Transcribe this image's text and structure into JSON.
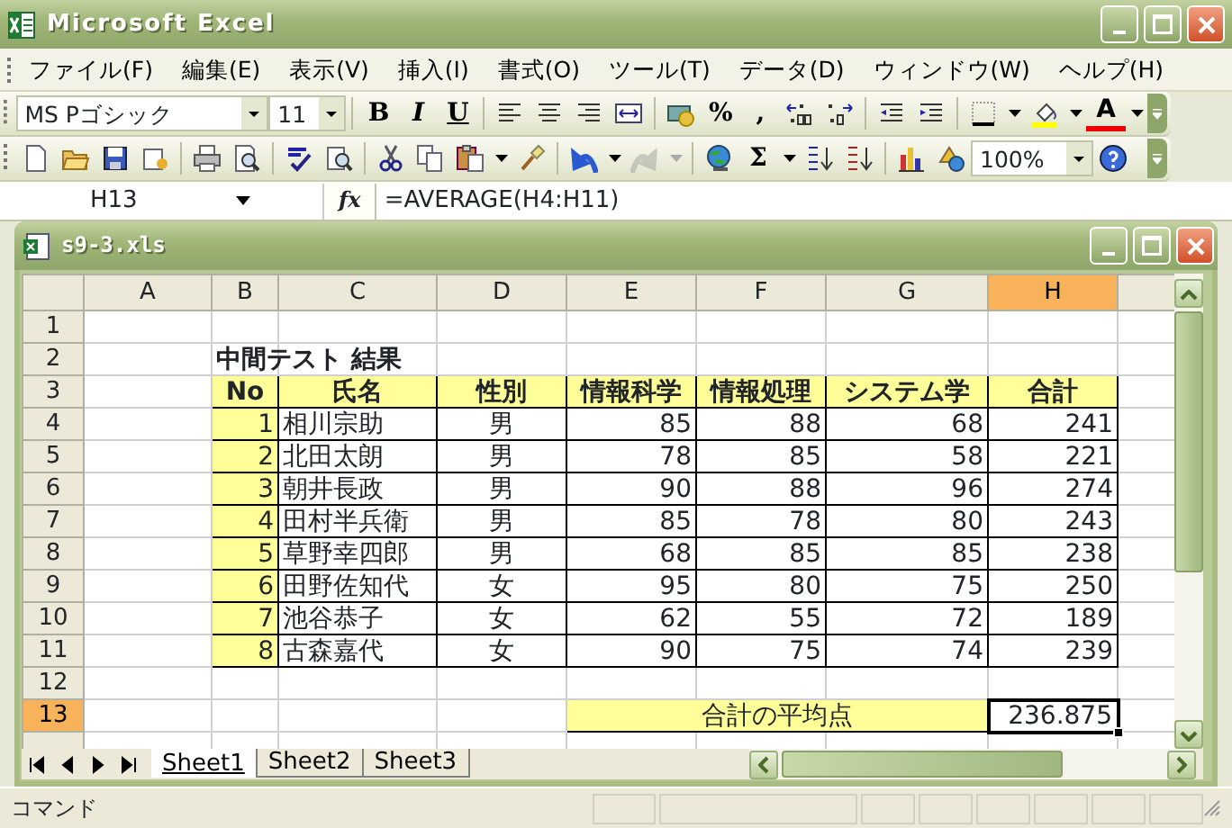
{
  "window": {
    "title": "Microsoft Excel"
  },
  "menu": [
    {
      "label": "ファイル(F)"
    },
    {
      "label": "編集(E)"
    },
    {
      "label": "表示(V)"
    },
    {
      "label": "挿入(I)"
    },
    {
      "label": "書式(O)"
    },
    {
      "label": "ツール(T)"
    },
    {
      "label": "データ(D)"
    },
    {
      "label": "ウィンドウ(W)"
    },
    {
      "label": "ヘルプ(H)"
    }
  ],
  "formatting_toolbar": [
    {
      "kind": "grip"
    },
    {
      "kind": "combo",
      "value": "MS Pゴシック"
    },
    {
      "kind": "combo",
      "value": "11"
    },
    {
      "kind": "sep"
    },
    {
      "kind": "glyph",
      "text": "B"
    },
    {
      "kind": "glyph",
      "text": "I"
    },
    {
      "kind": "glyph",
      "text": "U"
    },
    {
      "kind": "sep"
    },
    {
      "kind": "icon"
    },
    {
      "kind": "icon"
    },
    {
      "kind": "icon"
    },
    {
      "kind": "icon"
    },
    {
      "kind": "sep"
    },
    {
      "kind": "icon"
    },
    {
      "kind": "glyph",
      "text": "%"
    },
    {
      "kind": "glyph",
      "text": ","
    },
    {
      "kind": "icon"
    },
    {
      "kind": "icon"
    },
    {
      "kind": "sep"
    },
    {
      "kind": "icon"
    },
    {
      "kind": "icon"
    },
    {
      "kind": "sep"
    },
    {
      "kind": "icon"
    },
    {
      "kind": "dropdown"
    },
    {
      "kind": "icon"
    },
    {
      "kind": "dropdown"
    },
    {
      "kind": "glyph",
      "text": "A"
    },
    {
      "kind": "dropdown"
    },
    {
      "kind": "options"
    }
  ],
  "standard_toolbar": [
    {
      "kind": "grip"
    },
    {
      "kind": "icon",
      "disabled": false
    },
    {
      "kind": "icon",
      "disabled": false
    },
    {
      "kind": "icon",
      "disabled": false
    },
    {
      "kind": "icon",
      "disabled": false
    },
    {
      "kind": "sep"
    },
    {
      "kind": "icon",
      "disabled": false
    },
    {
      "kind": "icon",
      "disabled": false
    },
    {
      "kind": "sep"
    },
    {
      "kind": "icon",
      "disabled": false
    },
    {
      "kind": "icon",
      "disabled": false
    },
    {
      "kind": "sep"
    },
    {
      "kind": "icon",
      "disabled": false
    },
    {
      "kind": "icon",
      "disabled": false
    },
    {
      "kind": "icon",
      "disabled": false
    },
    {
      "kind": "dropdown",
      "disabled": false
    },
    {
      "kind": "icon",
      "disabled": false
    },
    {
      "kind": "sep"
    },
    {
      "kind": "icon",
      "disabled": false
    },
    {
      "kind": "dropdown",
      "disabled": false
    },
    {
      "kind": "icon",
      "disabled": true
    },
    {
      "kind": "dropdown",
      "disabled": true
    },
    {
      "kind": "sep"
    },
    {
      "kind": "icon",
      "disabled": false
    },
    {
      "kind": "glyph",
      "text": "Σ"
    },
    {
      "kind": "dropdown",
      "disabled": false
    },
    {
      "kind": "icon",
      "disabled": false
    },
    {
      "kind": "icon",
      "disabled": false
    },
    {
      "kind": "sep"
    },
    {
      "kind": "icon",
      "disabled": false
    },
    {
      "kind": "icon",
      "disabled": false
    },
    {
      "kind": "combo",
      "value": "100%"
    },
    {
      "kind": "icon",
      "disabled": false
    },
    {
      "kind": "options"
    }
  ],
  "formula_bar": {
    "name_box": "H13",
    "fx": "fx",
    "formula": "=AVERAGE(H4:H11)"
  },
  "workbook": {
    "title": "s9-3.xls"
  },
  "sheet": {
    "columns": [
      {
        "label": "A",
        "selected": false
      },
      {
        "label": "B",
        "selected": false
      },
      {
        "label": "C",
        "selected": false
      },
      {
        "label": "D",
        "selected": false
      },
      {
        "label": "E",
        "selected": false
      },
      {
        "label": "F",
        "selected": false
      },
      {
        "label": "G",
        "selected": false
      },
      {
        "label": "H",
        "selected": true
      }
    ],
    "row_headers": [
      {
        "label": "1",
        "selected": false
      },
      {
        "label": "2",
        "selected": false
      },
      {
        "label": "3",
        "selected": false
      },
      {
        "label": "4",
        "selected": false
      },
      {
        "label": "5",
        "selected": false
      },
      {
        "label": "6",
        "selected": false
      },
      {
        "label": "7",
        "selected": false
      },
      {
        "label": "8",
        "selected": false
      },
      {
        "label": "9",
        "selected": false
      },
      {
        "label": "10",
        "selected": false
      },
      {
        "label": "11",
        "selected": false
      },
      {
        "label": "12",
        "selected": false
      },
      {
        "label": "13",
        "selected": true
      }
    ],
    "title": "中間テスト 結果",
    "table": {
      "headers": [
        "No",
        "氏名",
        "性別",
        "情報科学",
        "情報処理",
        "システム学",
        "合計"
      ],
      "rows": [
        [
          "1",
          "相川宗助",
          "男",
          "85",
          "88",
          "68",
          "241"
        ],
        [
          "2",
          "北田太朗",
          "男",
          "78",
          "85",
          "58",
          "221"
        ],
        [
          "3",
          "朝井長政",
          "男",
          "90",
          "88",
          "96",
          "274"
        ],
        [
          "4",
          "田村半兵衛",
          "男",
          "85",
          "78",
          "80",
          "243"
        ],
        [
          "5",
          "草野幸四郎",
          "男",
          "68",
          "85",
          "85",
          "238"
        ],
        [
          "6",
          "田野佐知代",
          "女",
          "95",
          "80",
          "75",
          "250"
        ],
        [
          "7",
          "池谷恭子",
          "女",
          "62",
          "55",
          "72",
          "189"
        ],
        [
          "8",
          "古森嘉代",
          "女",
          "90",
          "75",
          "74",
          "239"
        ]
      ]
    },
    "summary": {
      "label": "合計の平均点",
      "value": "236.875",
      "selected": true
    }
  },
  "sheet_tabs": [
    {
      "label": "Sheet1",
      "selected": true
    },
    {
      "label": "Sheet2",
      "selected": false
    },
    {
      "label": "Sheet3",
      "selected": false
    }
  ],
  "status_bar": {
    "text": "コマンド"
  }
}
